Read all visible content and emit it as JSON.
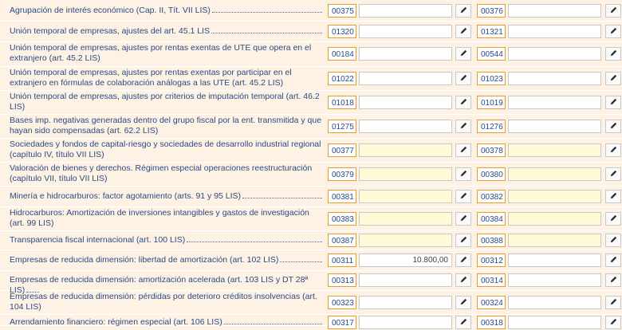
{
  "rows": [
    {
      "label": "Agrupación de interés económico (Cap. II, Tít. VII LIS)",
      "code1": "00375",
      "value1": "",
      "code2": "00376",
      "value2": "",
      "yellow": false
    },
    {
      "label": "Unión temporal de empresas, ajustes del art. 45.1 LIS",
      "code1": "01320",
      "value1": "",
      "code2": "01321",
      "value2": "",
      "yellow": false
    },
    {
      "label": "Unión temporal de empresas, ajustes por rentas exentas de UTE que opera en el extranjero (art. 45.2 LIS)",
      "code1": "00184",
      "value1": "",
      "code2": "00544",
      "value2": "",
      "yellow": false
    },
    {
      "label": "Unión temporal de empresas, ajustes por rentas exentas por participar en el extranjero en fórmulas de colaboración análogas a las UTE (art. 45.2 LIS)",
      "code1": "01022",
      "value1": "",
      "code2": "01023",
      "value2": "",
      "yellow": false
    },
    {
      "label": "Unión temporal de empresas, ajustes por criterios de imputación temporal (art. 46.2 LIS)",
      "code1": "01018",
      "value1": "",
      "code2": "01019",
      "value2": "",
      "yellow": false
    },
    {
      "label": "Bases imp. negativas generadas dentro del grupo fiscal por la ent. transmitida y que hayan sido compensadas (art. 62.2 LIS)",
      "code1": "01275",
      "value1": "",
      "code2": "01276",
      "value2": "",
      "yellow": false
    },
    {
      "label": "Sociedades y fondos de capital-riesgo y sociedades de desarrollo industrial regional (capítulo IV, título VII LIS)",
      "code1": "00377",
      "value1": "",
      "code2": "00378",
      "value2": "",
      "yellow": true
    },
    {
      "label": "Valoración de bienes y derechos. Régimen especial operaciones reestructuración (capítulo VII, título VII LIS)",
      "code1": "00379",
      "value1": "",
      "code2": "00380",
      "value2": "",
      "yellow": true
    },
    {
      "label": "Minería e hidrocarburos: factor agotamiento (arts. 91 y 95 LIS)",
      "code1": "00381",
      "value1": "",
      "code2": "00382",
      "value2": "",
      "yellow": true
    },
    {
      "label": "Hidrocarburos: Amortización de inversiones intangibles y gastos de investigación (art. 99 LIS)",
      "code1": "00383",
      "value1": "",
      "code2": "00384",
      "value2": "",
      "yellow": true
    },
    {
      "label": "Transparencia fiscal internacional (art. 100 LIS)",
      "code1": "00387",
      "value1": "",
      "code2": "00388",
      "value2": "",
      "yellow": true
    },
    {
      "label": "Empresas de reducida dimensión: libertad de amortización (art. 102 LIS)",
      "code1": "00311",
      "value1": "10.800,00",
      "code2": "00312",
      "value2": "",
      "yellow": false
    },
    {
      "label": "Empresas de reducida dimensión: amortización acelerada (art. 103 LIS y DT 28ª LIS)",
      "code1": "00313",
      "value1": "",
      "code2": "00314",
      "value2": "",
      "yellow": false
    },
    {
      "label": "Empresas de reducida dimensión: pérdidas por deterioro créditos insolvencias (art. 104 LIS)",
      "code1": "00323",
      "value1": "",
      "code2": "00324",
      "value2": "",
      "yellow": false
    },
    {
      "label": "Arrendamiento financiero: régimen especial (art. 106 LIS)",
      "code1": "00317",
      "value1": "",
      "code2": "00318",
      "value2": "",
      "yellow": false
    }
  ]
}
